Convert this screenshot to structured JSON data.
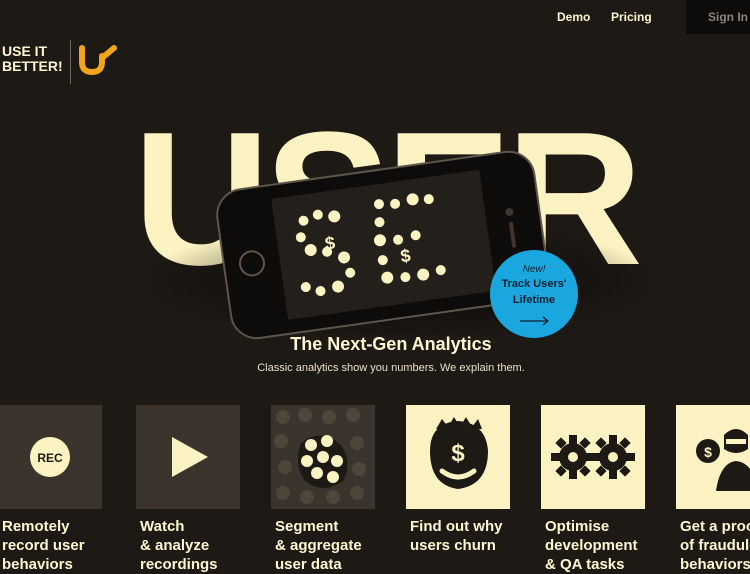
{
  "nav": {
    "demo": "Demo",
    "pricing": "Pricing",
    "sign_in": "Sign In"
  },
  "logo": {
    "line1": "USE IT",
    "line2": "BETTER!"
  },
  "hero": {
    "big_word": "USER",
    "headline": "The Next-Gen Analytics",
    "subline": "Classic analytics show you numbers. We explain them."
  },
  "badge": {
    "new": "New!",
    "line1": "Track Users'",
    "line2": "Lifetime"
  },
  "features": [
    {
      "label": "Remotely\nrecord user\nbehaviors",
      "tile_text": "REC",
      "icon": "rec-icon"
    },
    {
      "label": "Watch\n& analyze\nrecordings",
      "icon": "play-icon"
    },
    {
      "label": "Segment\n& aggregate\nuser data",
      "icon": "dots-icon"
    },
    {
      "label": "Find out why\nusers churn",
      "icon": "money-face-icon"
    },
    {
      "label": "Optimise\ndevelopment\n& QA tasks",
      "icon": "gears-icon"
    },
    {
      "label": "Get a proof\nof fraudulent\nbehaviors",
      "icon": "fraud-icon"
    }
  ],
  "colors": {
    "background": "#1d1915",
    "cream": "#fdf3c2",
    "accent_blue": "#1aa7e0",
    "logo_orange": "#f2a51c"
  }
}
